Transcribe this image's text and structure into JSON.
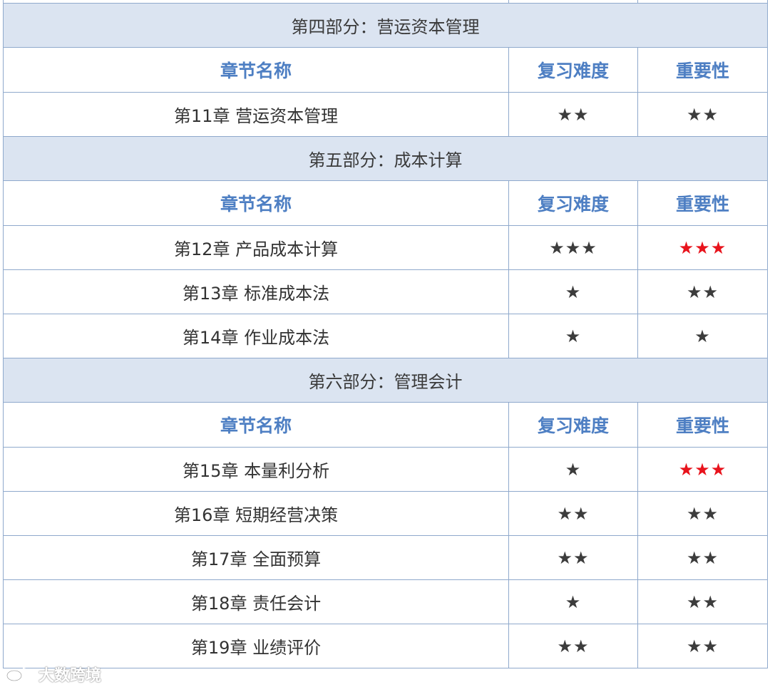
{
  "sections": [
    {
      "title": "第四部分：营运资本管理",
      "headers": [
        "章节名称",
        "复习难度",
        "重要性"
      ],
      "rows": [
        {
          "chapter": "第11章  营运资本管理",
          "difficulty": "★★",
          "importance": "★★",
          "importance_red": false
        }
      ]
    },
    {
      "title": "第五部分：成本计算",
      "headers": [
        "章节名称",
        "复习难度",
        "重要性"
      ],
      "rows": [
        {
          "chapter": "第12章  产品成本计算",
          "difficulty": "★★★",
          "importance": "★★★",
          "importance_red": true
        },
        {
          "chapter": "第13章  标准成本法",
          "difficulty": "★",
          "importance": "★★",
          "importance_red": false
        },
        {
          "chapter": "第14章  作业成本法",
          "difficulty": "★",
          "importance": "★",
          "importance_red": false
        }
      ]
    },
    {
      "title": "第六部分：管理会计",
      "headers": [
        "章节名称",
        "复习难度",
        "重要性"
      ],
      "rows": [
        {
          "chapter": "第15章  本量利分析",
          "difficulty": "★",
          "importance": "★★★",
          "importance_red": true
        },
        {
          "chapter": "第16章  短期经营决策",
          "difficulty": "★★",
          "importance": "★★",
          "importance_red": false
        },
        {
          "chapter": "第17章  全面预算",
          "difficulty": "★★",
          "importance": "★★",
          "importance_red": false
        },
        {
          "chapter": "第18章  责任会计",
          "difficulty": "★",
          "importance": "★★",
          "importance_red": false
        },
        {
          "chapter": "第19章  业绩评价",
          "difficulty": "★★",
          "importance": "★★",
          "importance_red": false
        }
      ]
    }
  ],
  "colors": {
    "header_text": "#4e7fc3",
    "section_bg": "#dbe4f1",
    "border": "#8fa9cc",
    "star_highlight": "#e8131c",
    "star_normal": "#3c3c3c"
  },
  "watermark": {
    "text": "大数跨境",
    "icon": "weibo-logo-icon"
  }
}
